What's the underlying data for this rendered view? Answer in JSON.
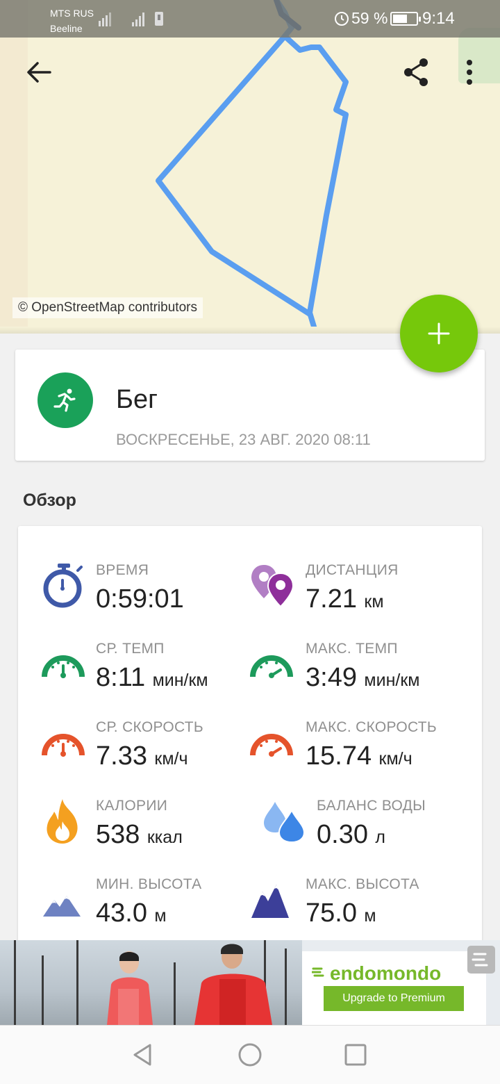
{
  "status_bar": {
    "carrier_primary": "MTS RUS",
    "carrier_secondary": "Beeline",
    "battery_percent": "59 %",
    "time": "9:14",
    "icons": [
      "signal-icon",
      "alarm-icon",
      "battery-icon"
    ]
  },
  "map": {
    "credit": "© OpenStreetMap contributors",
    "route_color": "#5a9ef0"
  },
  "toolbar": {
    "icons": [
      "back-arrow-icon",
      "share-icon",
      "more-vert-icon"
    ]
  },
  "fab": {
    "icon": "plus-icon",
    "color": "#76c80b"
  },
  "activity": {
    "sport": "Бег",
    "date": "ВОСКРЕСЕНЬЕ, 23 АВГ. 2020 08:11",
    "icon": "running-icon",
    "avatar_color": "#1aa159"
  },
  "overview": {
    "title": "Обзор",
    "stats": {
      "duration": {
        "label": "ВРЕМЯ",
        "value": "0:59:01",
        "unit": "",
        "icon": "stopwatch-icon"
      },
      "distance": {
        "label": "ДИСТАНЦИЯ",
        "value": "7.21",
        "unit": "км",
        "icon": "location-pin-icon"
      },
      "avg_pace": {
        "label": "СР. ТЕМП",
        "value": "8:11",
        "unit": "мин/км",
        "icon": "speedometer-icon"
      },
      "max_pace": {
        "label": "МАКС. ТЕМП",
        "value": "3:49",
        "unit": "мин/км",
        "icon": "speedometer-icon"
      },
      "avg_speed": {
        "label": "СР. СКОРОСТЬ",
        "value": "7.33",
        "unit": "км/ч",
        "icon": "speedometer-icon"
      },
      "max_speed": {
        "label": "МАКС. СКОРОСТЬ",
        "value": "15.74",
        "unit": "км/ч",
        "icon": "speedometer-icon"
      },
      "calories": {
        "label": "КАЛОРИИ",
        "value": "538",
        "unit": "ккал",
        "icon": "flame-icon"
      },
      "hydration": {
        "label": "БАЛАНС ВОДЫ",
        "value": "0.30",
        "unit": "л",
        "icon": "water-drops-icon"
      },
      "min_altitude": {
        "label": "МИН. ВЫСОТА",
        "value": "43.0",
        "unit": "м",
        "icon": "mountains-icon"
      },
      "max_altitude": {
        "label": "МАКС. ВЫСОТА",
        "value": "75.0",
        "unit": "м",
        "icon": "mountains-icon"
      }
    },
    "colors": {
      "stopwatch": "#3f59a8",
      "pin": "#8e4ba3",
      "pace": "#1d9a5b",
      "speed": "#e5532b",
      "flame": "#f4a020",
      "water": "#4b8fe8",
      "mountain_light": "#6e82c2",
      "mountain_dark": "#3c3f99"
    }
  },
  "ad": {
    "brand": "endomondo",
    "cta": "Upgrade to Premium",
    "brand_color": "#76b82a"
  },
  "nav_bar": {
    "icons": [
      "back-triangle-icon",
      "home-circle-icon",
      "recents-square-icon"
    ]
  }
}
